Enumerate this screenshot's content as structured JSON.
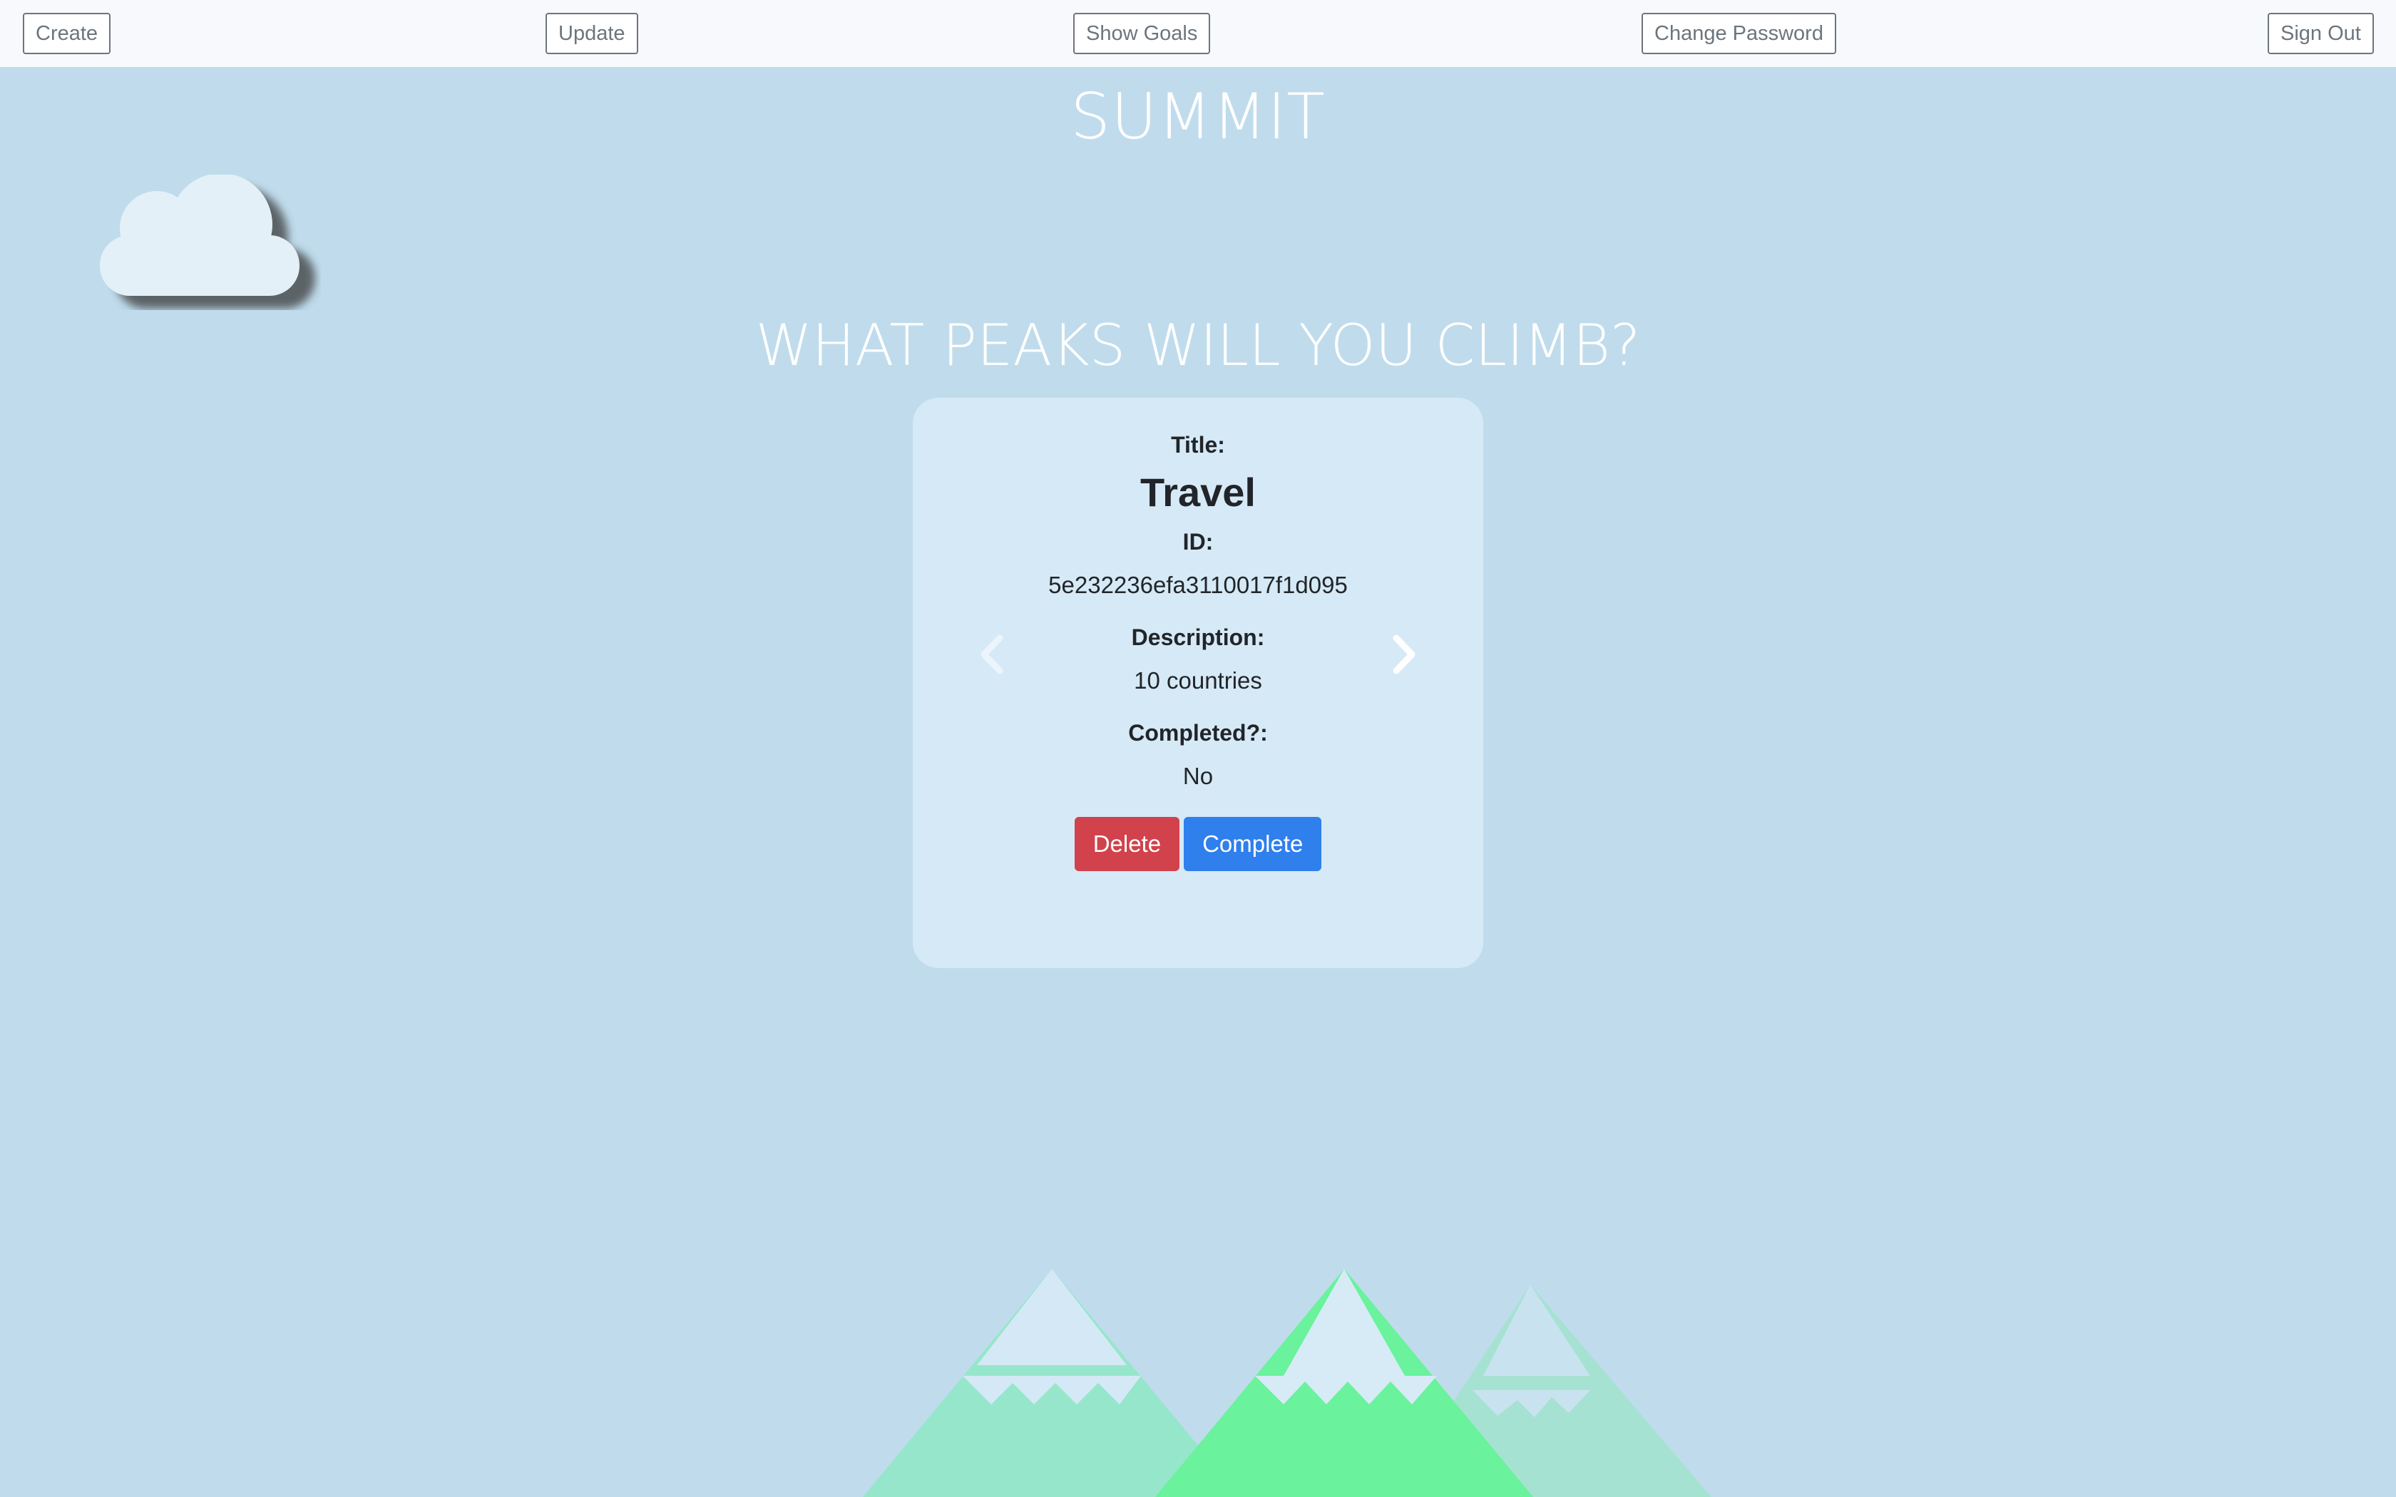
{
  "nav": {
    "create": "Create",
    "update": "Update",
    "show_goals": "Show Goals",
    "change_password": "Change Password",
    "sign_out": "Sign Out"
  },
  "brand": "SUMMIT",
  "headline": "WHAT PEAKS WILL YOU CLIMB?",
  "goal": {
    "title_label": "Title:",
    "title": "Travel",
    "id_label": "ID:",
    "id": "5e232236efa3110017f1d095",
    "description_label": "Description:",
    "description": "10 countries",
    "completed_label": "Completed?:",
    "completed": "No"
  },
  "actions": {
    "delete": "Delete",
    "complete": "Complete"
  },
  "colors": {
    "background": "#c0dcec",
    "card": "#d6e9f6",
    "delete": "#d1424c",
    "complete": "#2f7fec",
    "mountain_green": "#6af29c"
  },
  "icons": {
    "prev": "chevron-left-icon",
    "next": "chevron-right-icon",
    "cloud": "cloud-icon"
  }
}
